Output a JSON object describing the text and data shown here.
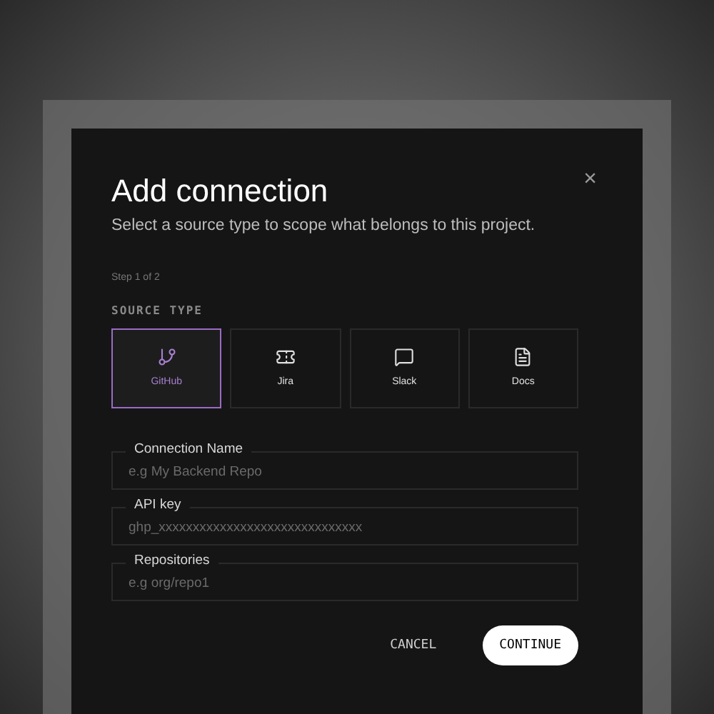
{
  "dialog": {
    "title": "Add connection",
    "subtitle": "Select a source type to scope what belongs to this project.",
    "close": "×",
    "step": "Step 1 of 2",
    "section_label": "SOURCE TYPE",
    "source_types": [
      {
        "kind": "branch",
        "label": "GitHub",
        "selected": true
      },
      {
        "kind": "ticket",
        "label": "Jira",
        "selected": false
      },
      {
        "kind": "chat",
        "label": "Slack",
        "selected": false
      },
      {
        "kind": "doc",
        "label": "Docs",
        "selected": false
      }
    ],
    "fields": [
      {
        "label": "Connection Name",
        "placeholder": "e.g My Backend Repo"
      },
      {
        "label": "API key",
        "placeholder": "ghp_xxxxxxxxxxxxxxxxxxxxxxxxxxxxxx"
      },
      {
        "label": "Repositories",
        "placeholder": "e.g org/repo1"
      }
    ],
    "buttons": [
      {
        "kind": "secondary",
        "label": "CANCEL"
      },
      {
        "kind": "primary",
        "label": "CONTINUE"
      }
    ]
  }
}
